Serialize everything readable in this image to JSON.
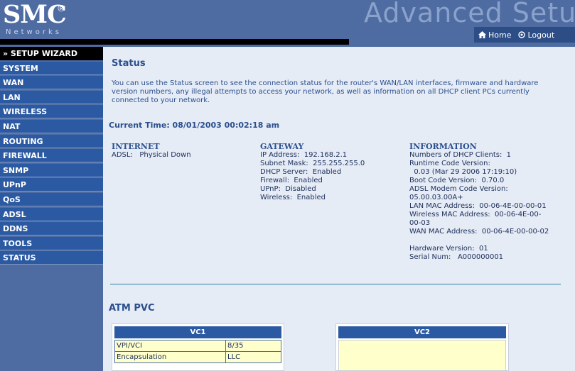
{
  "header": {
    "logo_text": "SMC",
    "logo_reg": "®",
    "logo_sub": "Networks",
    "title": "Advanced Setup",
    "home_label": "Home",
    "logout_label": "Logout"
  },
  "sidebar": {
    "items": [
      {
        "label": "» SETUP WIZARD"
      },
      {
        "label": "SYSTEM"
      },
      {
        "label": "WAN"
      },
      {
        "label": "LAN"
      },
      {
        "label": "WIRELESS"
      },
      {
        "label": "NAT"
      },
      {
        "label": "ROUTING"
      },
      {
        "label": "FIREWALL"
      },
      {
        "label": "SNMP"
      },
      {
        "label": "UPnP"
      },
      {
        "label": "QoS"
      },
      {
        "label": "ADSL"
      },
      {
        "label": "DDNS"
      },
      {
        "label": "TOOLS"
      },
      {
        "label": "STATUS"
      }
    ]
  },
  "main": {
    "title": "Status",
    "intro": "You can use the Status screen to see the connection status for the router's WAN/LAN interfaces, firmware and hardware version numbers, any illegal attempts to access your network, as well as information on all DHCP client PCs currently connected to your network.",
    "current_time": "Current Time: 08/01/2003 00:02:18 am",
    "internet": {
      "heading": "INTERNET",
      "rows": [
        "ADSL:   Physical Down"
      ]
    },
    "gateway": {
      "heading": "GATEWAY",
      "rows": [
        "IP Address:  192.168.2.1",
        "Subnet Mask:  255.255.255.0",
        "DHCP Server:  Enabled",
        "Firewall:  Enabled",
        "UPnP:  Disabled",
        "Wireless:  Enabled"
      ]
    },
    "information": {
      "heading": "INFORMATION",
      "rows": [
        "Numbers of DHCP Clients:  1",
        "Runtime Code Version:",
        "  0.03 (Mar 29 2006 17:19:10)",
        "Boot Code Version:  0.70.0",
        "ADSL Modem Code Version:",
        "05.00.03.00A+",
        "LAN MAC Address:  00-06-4E-00-00-01",
        "Wireless MAC Address:  00-06-4E-00-",
        "00-03",
        "WAN MAC Address:  00-06-4E-00-00-02",
        "",
        "Hardware Version:  01",
        "Serial Num:   A000000001"
      ]
    },
    "atm": {
      "title": "ATM PVC",
      "vc1": {
        "header": "VC1",
        "rows": [
          {
            "key": "VPI/VCI",
            "value": "8/35"
          },
          {
            "key": "Encapsulation",
            "value": "LLC"
          }
        ]
      },
      "vc2": {
        "header": "VC2"
      }
    }
  },
  "colors": {
    "header_bg": "#4e6ca2",
    "menu_bg": "#2c5aa2",
    "content_bg": "#e6ecf6",
    "title_text": "#2a4f8e",
    "table_cell": "#ffffcc"
  }
}
